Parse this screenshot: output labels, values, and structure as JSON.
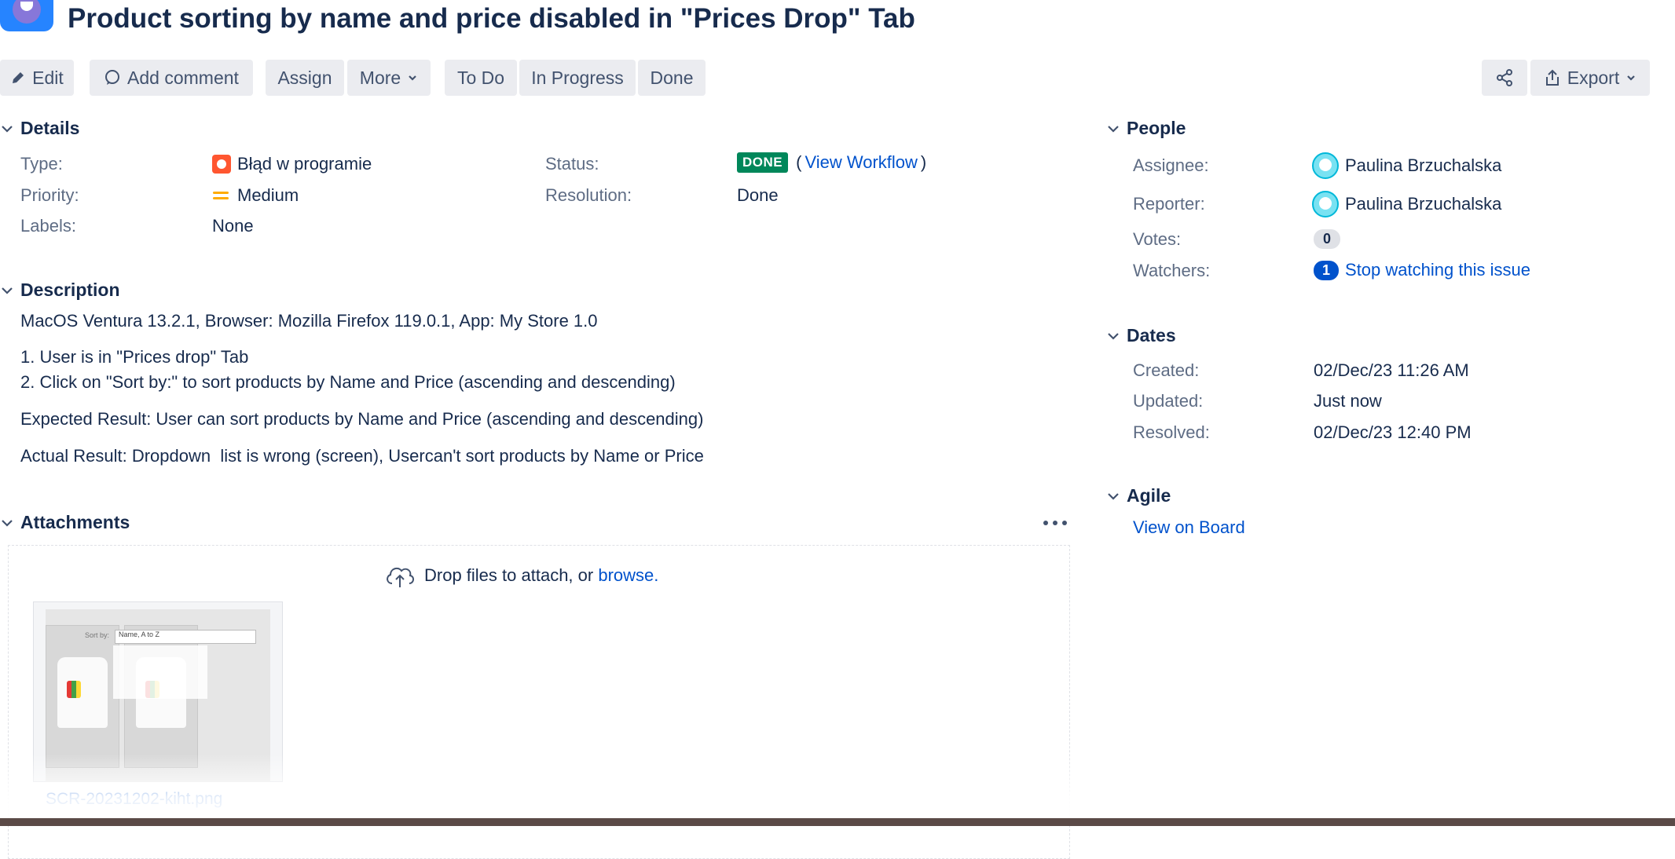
{
  "issue": {
    "title": "Product sorting by name and price disabled in \"Prices Drop\" Tab"
  },
  "toolbar": {
    "edit": "Edit",
    "add_comment": "Add comment",
    "assign": "Assign",
    "more": "More",
    "to_do": "To Do",
    "in_progress": "In Progress",
    "done": "Done",
    "export": "Export"
  },
  "details": {
    "heading": "Details",
    "type_label": "Type:",
    "type_value": "Błąd w programie",
    "priority_label": "Priority:",
    "priority_value": "Medium",
    "labels_label": "Labels:",
    "labels_value": "None",
    "status_label": "Status:",
    "status_value": "DONE",
    "view_workflow": "View Workflow",
    "resolution_label": "Resolution:",
    "resolution_value": "Done"
  },
  "description": {
    "heading": "Description",
    "line1": "MacOS Ventura 13.2.1, Browser: Mozilla Firefox 119.0.1, App: My Store 1.0",
    "line2": "1. User is in \"Prices drop\" Tab",
    "line3": "2. Click on \"Sort by:\" to sort products by Name and Price (ascending and descending)",
    "line4": "Expected Result: User can sort products by Name and Price (ascending and descending)",
    "line5": "Actual Result: Dropdown  list is wrong (screen), Usercan't sort products by Name or Price"
  },
  "attachments": {
    "heading": "Attachments",
    "drop_text": "Drop files to attach, or ",
    "browse": "browse.",
    "file_name": "SCR-20231202-kiht.png",
    "thumb_sort_label": "Sort by:",
    "thumb_sort_value": "Name, A to Z"
  },
  "people": {
    "heading": "People",
    "assignee_label": "Assignee:",
    "assignee_value": "Paulina Brzuchalska",
    "reporter_label": "Reporter:",
    "reporter_value": "Paulina Brzuchalska",
    "votes_label": "Votes:",
    "votes_value": "0",
    "watchers_label": "Watchers:",
    "watchers_count": "1",
    "stop_watching": "Stop watching this issue"
  },
  "dates": {
    "heading": "Dates",
    "created_label": "Created:",
    "created_value": "02/Dec/23 11:26 AM",
    "updated_label": "Updated:",
    "updated_value": "Just now",
    "resolved_label": "Resolved:",
    "resolved_value": "02/Dec/23 12:40 PM"
  },
  "agile": {
    "heading": "Agile",
    "view_on_board": "View on Board"
  },
  "colors": {
    "link": "#0052cc",
    "done_lozenge": "#00875a",
    "bug_icon": "#ff5630",
    "priority_medium": "#ffab00"
  }
}
